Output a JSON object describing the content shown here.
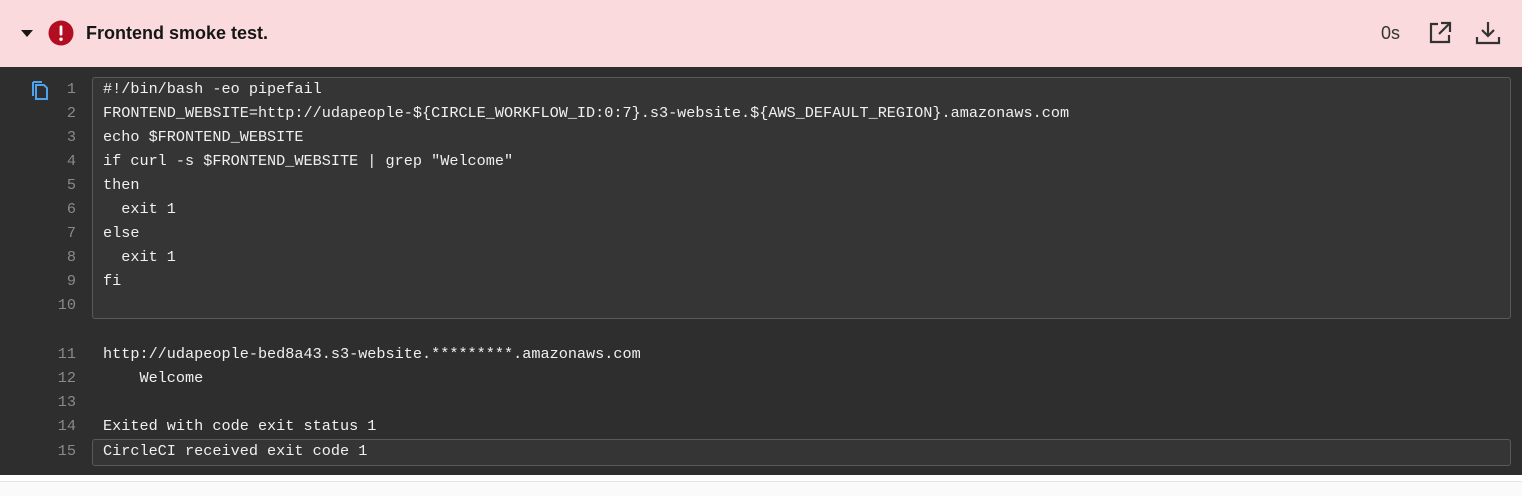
{
  "step": {
    "title": "Frontend smoke test.",
    "duration": "0s",
    "status": "failed",
    "status_color": "#b30d22",
    "icons": {
      "toggle": "caret-down-icon",
      "status": "error-circle-icon",
      "open": "open-external-icon",
      "download": "download-icon",
      "copy": "copy-icon"
    }
  },
  "terminal": {
    "lines": [
      {
        "n": "1",
        "text": "#!/bin/bash -eo pipefail"
      },
      {
        "n": "2",
        "text": "FRONTEND_WEBSITE=http://udapeople-${CIRCLE_WORKFLOW_ID:0:7}.s3-website.${AWS_DEFAULT_REGION}.amazonaws.com"
      },
      {
        "n": "3",
        "text": "echo $FRONTEND_WEBSITE"
      },
      {
        "n": "4",
        "text": "if curl -s $FRONTEND_WEBSITE | grep \"Welcome\""
      },
      {
        "n": "5",
        "text": "then"
      },
      {
        "n": "6",
        "text": "  exit 1"
      },
      {
        "n": "7",
        "text": "else"
      },
      {
        "n": "8",
        "text": "  exit 1"
      },
      {
        "n": "9",
        "text": "fi"
      },
      {
        "n": "10",
        "text": ""
      },
      {
        "n": "11",
        "text": "http://udapeople-bed8a43.s3-website.*********.amazonaws.com"
      },
      {
        "n": "12",
        "text": "    Welcome"
      },
      {
        "n": "13",
        "text": ""
      },
      {
        "n": "14",
        "text": "Exited with code exit status 1"
      },
      {
        "n": "15",
        "text": "CircleCI received exit code 1"
      }
    ]
  }
}
